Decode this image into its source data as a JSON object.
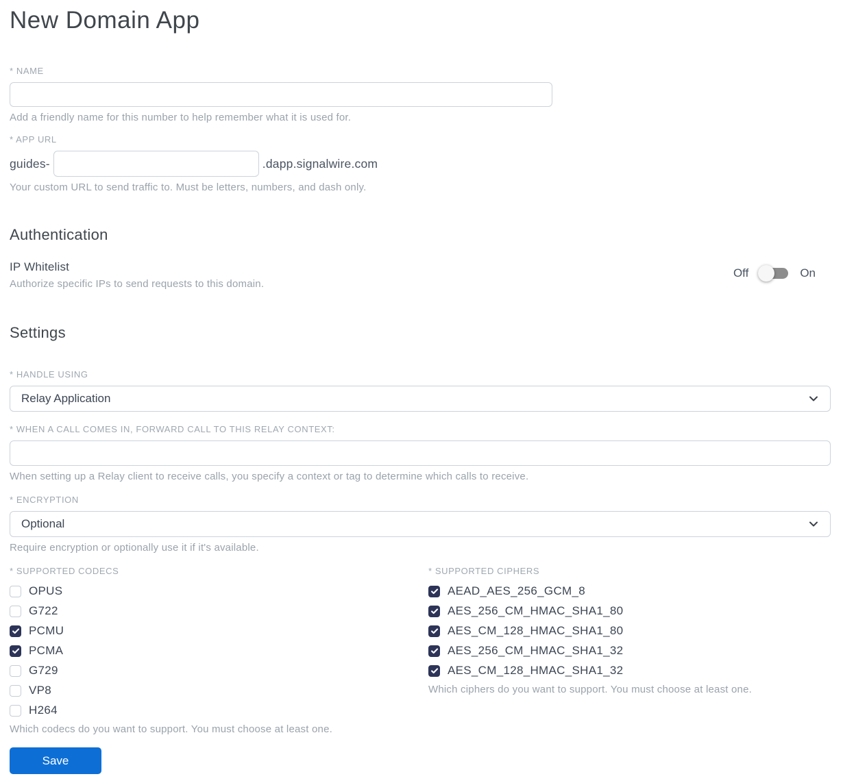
{
  "page": {
    "title": "New Domain App"
  },
  "form": {
    "name": {
      "label": "* NAME",
      "value": "",
      "helper": "Add a friendly name for this number to help remember what it is used for."
    },
    "app_url": {
      "label": "* APP URL",
      "prefix": "guides-",
      "value": "",
      "suffix": ".dapp.signalwire.com",
      "helper": "Your custom URL to send traffic to. Must be letters, numbers, and dash only."
    },
    "authentication": {
      "heading": "Authentication",
      "ip_whitelist": {
        "label": "IP Whitelist",
        "helper": "Authorize specific IPs to send requests to this domain.",
        "off_label": "Off",
        "on_label": "On",
        "state": "off"
      }
    },
    "settings": {
      "heading": "Settings",
      "handle_using": {
        "label": "* HANDLE USING",
        "value": "Relay Application"
      },
      "relay_context": {
        "label": "* WHEN A CALL COMES IN, FORWARD CALL TO THIS RELAY CONTEXT:",
        "value": "",
        "helper": "When setting up a Relay client to receive calls, you specify a context or tag to determine which calls to receive."
      },
      "encryption": {
        "label": "* ENCRYPTION",
        "value": "Optional",
        "helper": "Require encryption or optionally use it if it's available."
      },
      "codecs": {
        "label": "* SUPPORTED CODECS",
        "helper": "Which codecs do you want to support. You must choose at least one.",
        "options": [
          {
            "label": "OPUS",
            "checked": false
          },
          {
            "label": "G722",
            "checked": false
          },
          {
            "label": "PCMU",
            "checked": true
          },
          {
            "label": "PCMA",
            "checked": true
          },
          {
            "label": "G729",
            "checked": false
          },
          {
            "label": "VP8",
            "checked": false
          },
          {
            "label": "H264",
            "checked": false
          }
        ]
      },
      "ciphers": {
        "label": "* SUPPORTED CIPHERS",
        "helper": "Which ciphers do you want to support. You must choose at least one.",
        "options": [
          {
            "label": "AEAD_AES_256_GCM_8",
            "checked": true
          },
          {
            "label": "AES_256_CM_HMAC_SHA1_80",
            "checked": true
          },
          {
            "label": "AES_CM_128_HMAC_SHA1_80",
            "checked": true
          },
          {
            "label": "AES_256_CM_HMAC_SHA1_32",
            "checked": true
          },
          {
            "label": "AES_CM_128_HMAC_SHA1_32",
            "checked": true
          }
        ]
      }
    },
    "save_label": "Save"
  },
  "colors": {
    "save_button_blue": "#0d6fd6",
    "checkbox_checked_navy": "#2d3458",
    "toggle_track_gray": "#8d8d8d",
    "label_gray": "#9fa8b0",
    "helper_gray": "#9aa3ab",
    "input_border": "#ccd3da",
    "dark_text": "#3c4654"
  }
}
